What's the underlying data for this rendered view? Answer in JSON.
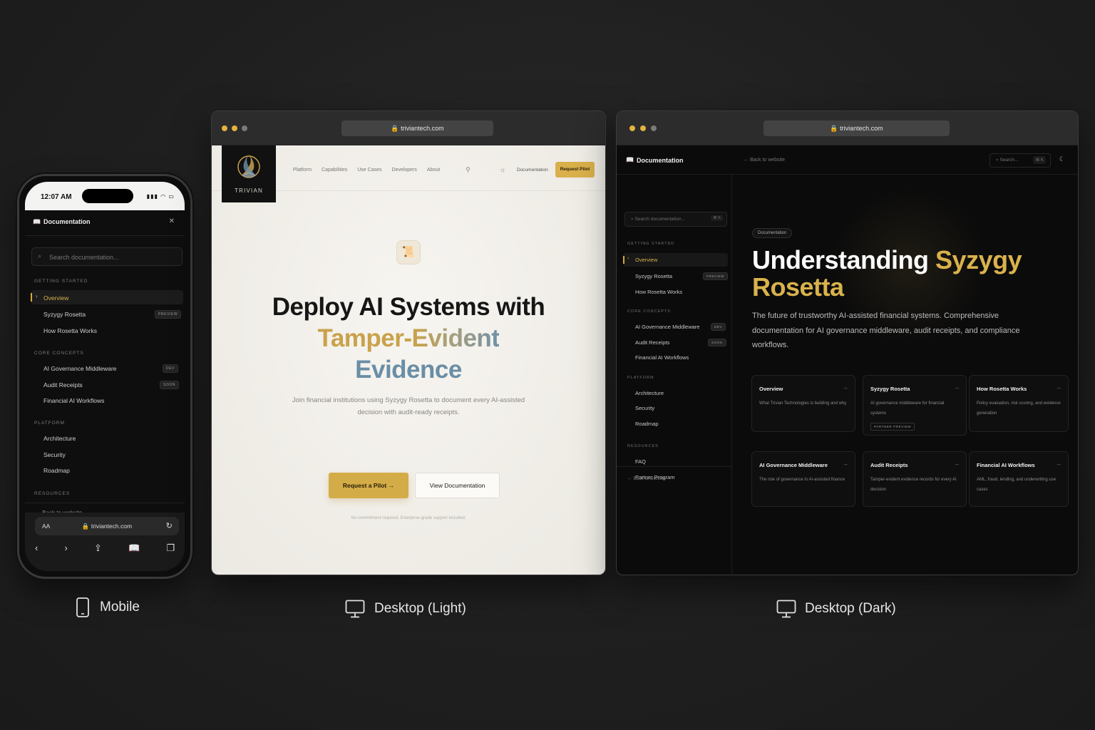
{
  "colors": {
    "gold": "#d4ac47",
    "blue": "#6a8ea6",
    "dark_bg": "#0b0b0b",
    "light_bg": "#f4f2ee"
  },
  "mobile": {
    "status_time": "12:07 AM",
    "header_title": "Documentation",
    "search_placeholder": "Search documentation...",
    "sections": [
      {
        "title": "GETTING STARTED",
        "items": [
          {
            "label": "Overview",
            "badge": ""
          },
          {
            "label": "Syzygy Rosetta",
            "badge": "PREVIEW"
          },
          {
            "label": "How Rosetta Works",
            "badge": ""
          }
        ]
      },
      {
        "title": "CORE CONCEPTS",
        "items": [
          {
            "label": "AI Governance Middleware",
            "badge": "DEV"
          },
          {
            "label": "Audit Receipts",
            "badge": "SOON"
          },
          {
            "label": "Financial AI Workflows",
            "badge": ""
          }
        ]
      },
      {
        "title": "PLATFORM",
        "items": [
          {
            "label": "Architecture"
          },
          {
            "label": "Security"
          },
          {
            "label": "Roadmap"
          }
        ]
      },
      {
        "title": "RESOURCES",
        "items": []
      }
    ],
    "back_link": "Back to website",
    "url_aa": "AA",
    "url": "triviantech.com"
  },
  "light": {
    "url": "triviantech.com",
    "logo_text": "TRIVIAN",
    "nav": [
      "Platform",
      "Capabilities",
      "Use Cases",
      "Developers",
      "About"
    ],
    "doc_link": "Documentation",
    "request_btn": "Request Pilot",
    "headline_1": "Deploy AI Systems with",
    "headline_2a": "Tamper-",
    "headline_2b": "Evident",
    "headline_3": "Evidence",
    "subtitle": "Join financial institutions using Syzygy Rosetta to document every AI-assisted decision with audit-ready receipts.",
    "cta_primary": "Request a Pilot",
    "cta_secondary": "View Documentation",
    "note": "No commitment required. Enterprise-grade support included."
  },
  "dark": {
    "url": "triviantech.com",
    "header_title": "Documentation",
    "back_top": "Back to website",
    "search_top": "Search...",
    "search_kbd": "⌘ K",
    "side_search": "Search documentation...",
    "side_kbd": "⌘ K",
    "sections": [
      {
        "title": "GETTING STARTED",
        "items": [
          {
            "label": "Overview",
            "badge": ""
          },
          {
            "label": "Syzygy Rosetta",
            "badge": "PREVIEW"
          },
          {
            "label": "How Rosetta Works",
            "badge": ""
          }
        ]
      },
      {
        "title": "CORE CONCEPTS",
        "items": [
          {
            "label": "AI Governance Middleware",
            "badge": "DEV"
          },
          {
            "label": "Audit Receipts",
            "badge": "SOON"
          },
          {
            "label": "Financial AI Workflows",
            "badge": ""
          }
        ]
      },
      {
        "title": "PLATFORM",
        "items": [
          {
            "label": "Architecture"
          },
          {
            "label": "Security"
          },
          {
            "label": "Roadmap"
          }
        ]
      },
      {
        "title": "RESOURCES",
        "items": [
          {
            "label": "FAQ"
          },
          {
            "label": "Partner Program"
          }
        ]
      }
    ],
    "side_back": "Back to website",
    "pill": "Documentation",
    "h1_a": "Understanding",
    "h1_b": "Syzygy",
    "h1_c": "Rosetta",
    "subtitle": "The future of trustworthy AI-assisted financial systems. Comprehensive documentation for AI governance middleware, audit receipts, and compliance workflows.",
    "cards": [
      {
        "title": "Overview",
        "desc": "What Trivian Technologies is building and why",
        "badge": ""
      },
      {
        "title": "Syzygy Rosetta",
        "desc": "AI governance middleware for financial systems",
        "badge": "PARTNER PREVIEW"
      },
      {
        "title": "How Rosetta Works",
        "desc": "Policy evaluation, risk scoring, and evidence generation",
        "badge": ""
      },
      {
        "title": "AI Governance Middleware",
        "desc": "The role of governance in AI-assisted finance",
        "badge": ""
      },
      {
        "title": "Audit Receipts",
        "desc": "Tamper-evident evidence records for every AI decision",
        "badge": ""
      },
      {
        "title": "Financial AI Workflows",
        "desc": "AML, fraud, lending, and underwriting use cases",
        "badge": ""
      }
    ]
  },
  "captions": {
    "mobile": "Mobile",
    "light": "Desktop (Light)",
    "dark": "Desktop (Dark)"
  },
  "icons": [
    "lock-icon",
    "book-icon",
    "close-icon",
    "search-icon",
    "chevron-right-icon",
    "arrow-left-icon",
    "arrow-right-icon",
    "sun-icon",
    "moon-icon",
    "github-icon",
    "scroll-icon",
    "phone-icon",
    "monitor-icon",
    "share-icon",
    "tabs-icon",
    "reload-icon"
  ]
}
